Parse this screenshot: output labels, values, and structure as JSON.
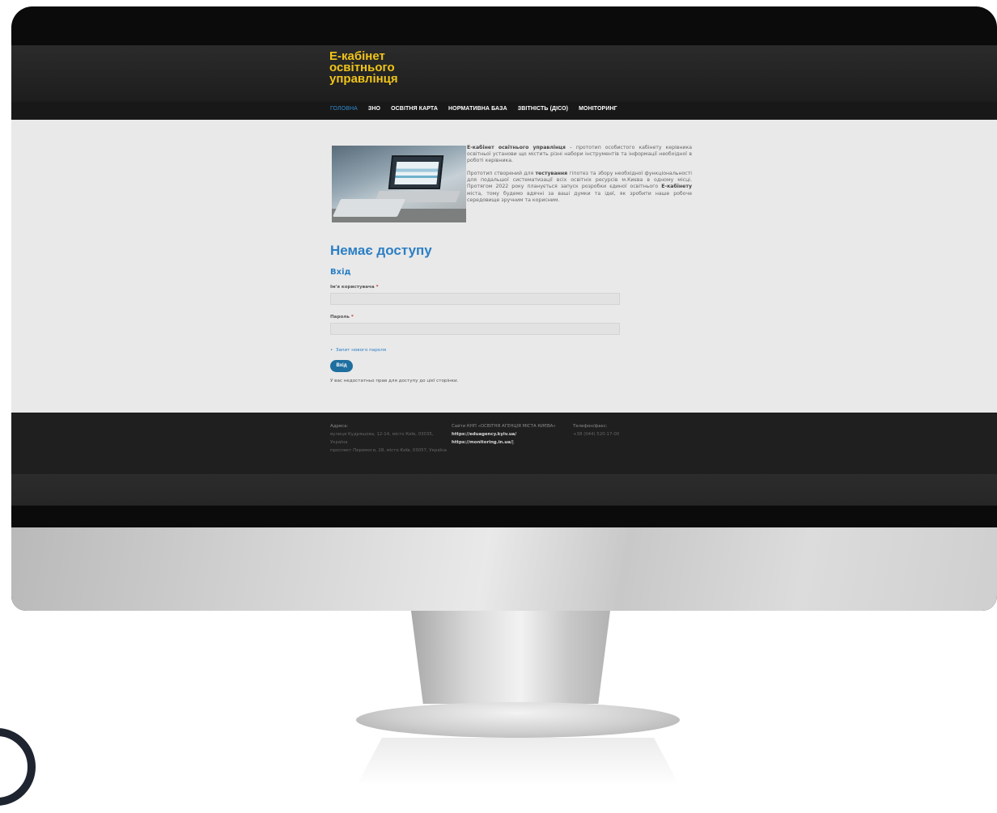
{
  "site": {
    "logo_lines": [
      "Е-кабінет",
      "освітнього",
      "управлінця"
    ]
  },
  "nav": {
    "items": [
      {
        "label": "ГОЛОВНА",
        "active": true
      },
      {
        "label": "ЗНО",
        "active": false
      },
      {
        "label": "ОСВІТНЯ КАРТА",
        "active": false
      },
      {
        "label": "НОРМАТИВНА БАЗА",
        "active": false
      },
      {
        "label": "ЗВІТНІСТЬ (ДІСО)",
        "active": false
      },
      {
        "label": "МОНІТОРИНГ",
        "active": false
      }
    ]
  },
  "intro": {
    "p1_bold": "Е-кабінет освітнього управлінця",
    "p1_rest": " – прототип особистого кабінету керівника освітньої установи що містить різні набори інструментів та інформації необхідної в роботі керівника.",
    "p2_a": "Прототип створений для ",
    "p2_bold": "тестування",
    "p2_b": " гіпотез та збору необхідної функціональності для подальшої систематизації всіх освітніх ресурсів м.Києва в одному місці. Протягом 2022 року планується запуск розробки єдиної освітнього ",
    "p2_bold2": "Е-кабінету",
    "p2_c": " міста, тому будемо вдячні за ваші думки та ідеї, як зробити наше робоче середовище зручним та корисним."
  },
  "login": {
    "page_title": "Немає доступу",
    "section_title": "Вхід",
    "username_label": "Ім'я користувача",
    "password_label": "Пароль",
    "required_mark": "*",
    "reset_link": "Запит нового пароля",
    "submit_label": "Вхід",
    "notice": "У вас недостатньо прав для доступу до цієї сторінки."
  },
  "footer": {
    "address_heading": "Адреса:",
    "address_lines": [
      "вулиця Кудряшова, 12-14, місто Київ, 03035, Україна",
      "проспект Перемоги, 28, місто Київ, 03057, Україна"
    ],
    "sites_heading": "Сайти КНП «ОСВІТНЯ АГЕНЦІЯ МІСТА КИЄВА»",
    "sites": [
      "https://eduagency.kyiv.ua/",
      "https://monitoring.in.ua/|"
    ],
    "phone_heading": "Телефон/факс:",
    "phone": "+38 (044) 520-17-00"
  },
  "colors": {
    "logo": "#f0c419",
    "accent": "#2b7fc4",
    "button": "#1e6f9f",
    "header": "#1d1d1d"
  }
}
